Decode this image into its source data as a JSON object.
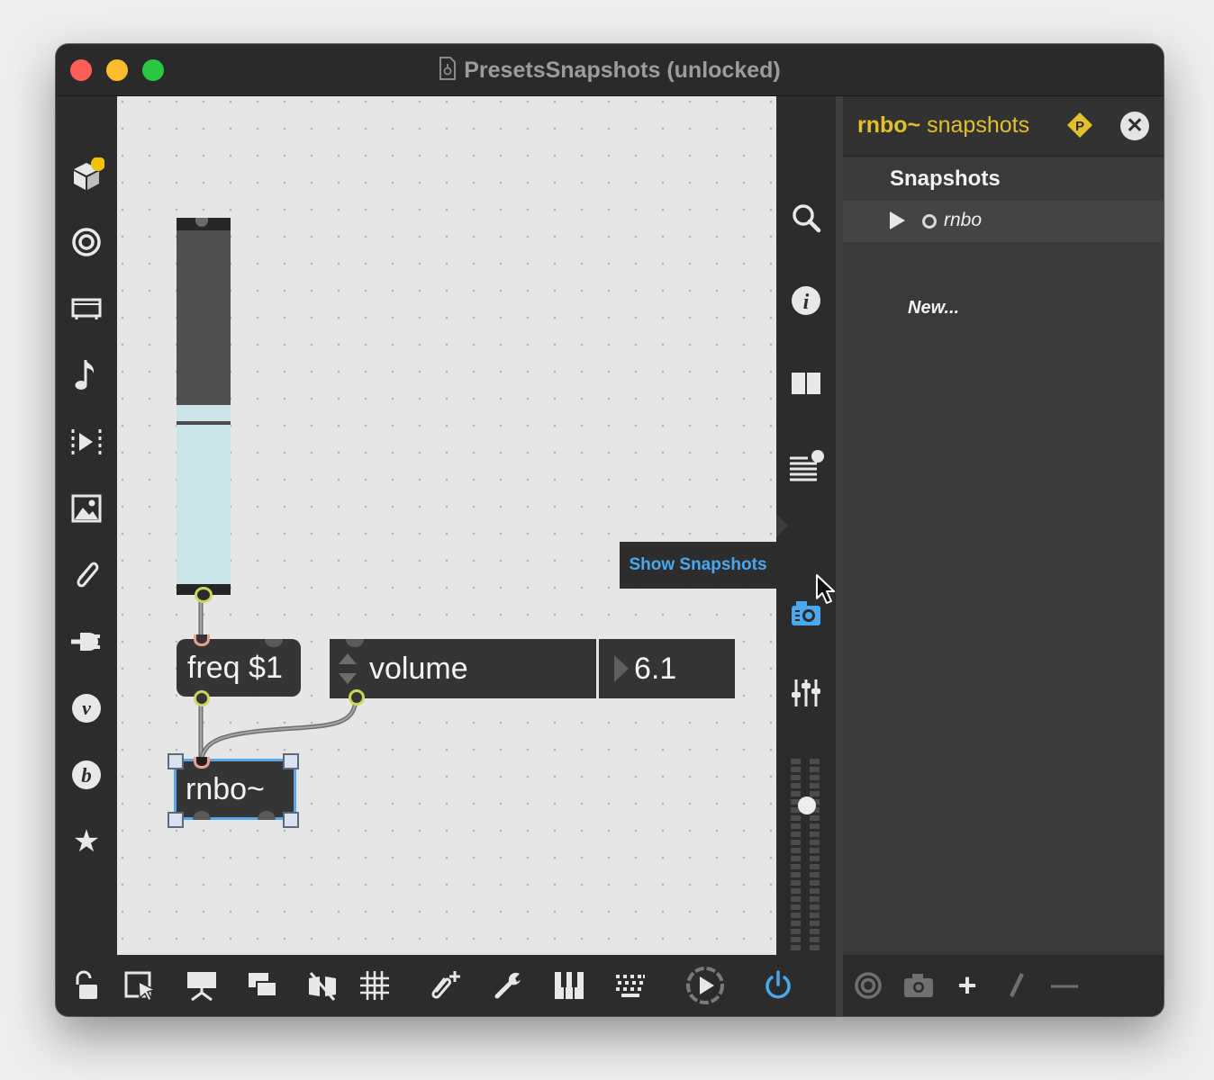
{
  "window": {
    "title": "PresetsSnapshots (unlocked)"
  },
  "left_toolbar": [
    {
      "icon": "package-icon"
    },
    {
      "icon": "target-icon"
    },
    {
      "icon": "display-icon"
    },
    {
      "icon": "music-note-icon"
    },
    {
      "icon": "transport-icon"
    },
    {
      "icon": "image-icon"
    },
    {
      "icon": "paperclip-icon"
    },
    {
      "icon": "plug-icon"
    },
    {
      "icon": "v-icon",
      "glyph": "v"
    },
    {
      "icon": "b-icon",
      "glyph": "b"
    },
    {
      "icon": "star-icon",
      "glyph": "★"
    }
  ],
  "right_toolbar": [
    {
      "icon": "search-icon"
    },
    {
      "icon": "info-icon",
      "glyph": "i"
    },
    {
      "icon": "columns-icon"
    },
    {
      "icon": "list-icon"
    },
    {
      "icon": "camera-icon",
      "active_color": "#49a8f0"
    },
    {
      "icon": "mixer-icon"
    }
  ],
  "tooltip": {
    "text": "Show Snapshots"
  },
  "patch": {
    "message_box": "freq $1",
    "attrui": {
      "attribute": "volume",
      "value": "6.1"
    },
    "rnbo_object": "rnbo~",
    "slider_level": 0.52
  },
  "snapshots_panel": {
    "title_bold": "rnbo~",
    "title_rest": " snapshots",
    "badge": "P",
    "close_glyph": "✕",
    "section": "Snapshots",
    "items": [
      {
        "name": "rnbo"
      }
    ],
    "new_label": "New..."
  },
  "bottom_toolbar": [
    {
      "icon": "lock-icon"
    },
    {
      "icon": "presentation-pointer-icon"
    },
    {
      "icon": "presentation-icon"
    },
    {
      "icon": "layers-icon"
    },
    {
      "icon": "hide-icon"
    },
    {
      "icon": "grid-icon"
    },
    {
      "icon": "add-attachment-icon"
    },
    {
      "icon": "wrench-icon"
    },
    {
      "icon": "piano-icon"
    },
    {
      "icon": "keyboard-icon"
    },
    {
      "icon": "play-icon"
    },
    {
      "icon": "power-icon",
      "active_color": "#49a8f0"
    }
  ],
  "panel_toolbar": [
    {
      "icon": "target-icon"
    },
    {
      "icon": "camera-icon"
    },
    {
      "icon": "plus-icon",
      "glyph": "+"
    },
    {
      "icon": "pencil-icon"
    },
    {
      "icon": "minus-icon",
      "glyph": "—"
    }
  ],
  "colors": {
    "accent": "#49a8f0",
    "panel_title": "#e2c12a",
    "selection": "#5aa7ea"
  }
}
